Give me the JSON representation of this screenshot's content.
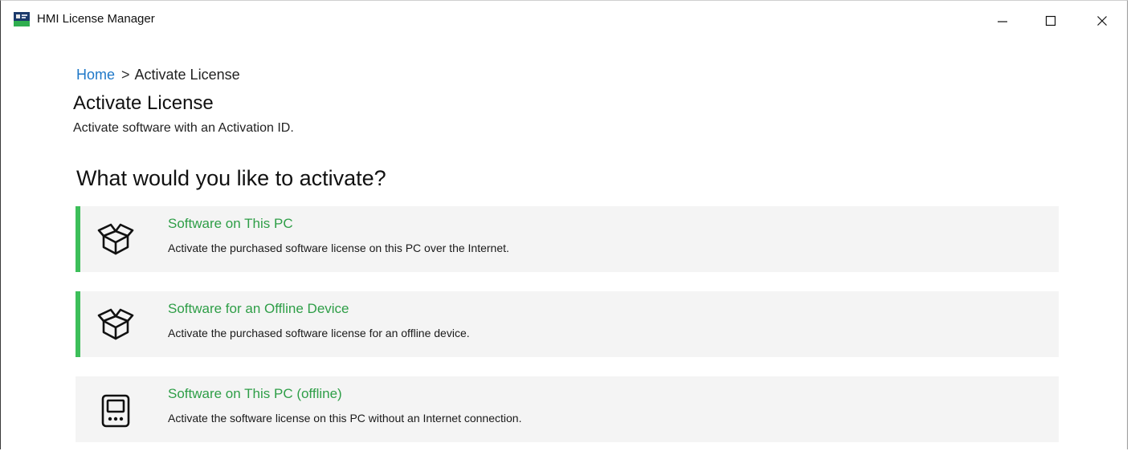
{
  "window": {
    "title": "HMI License Manager",
    "controls": {
      "minimize": "minimize-icon",
      "maximize": "maximize-icon",
      "close": "close-icon"
    }
  },
  "breadcrumb": {
    "home": "Home",
    "separator": ">",
    "current": "Activate License"
  },
  "page": {
    "title": "Activate License",
    "subtitle": "Activate software with an Activation ID."
  },
  "section": {
    "heading": "What would you like to activate?"
  },
  "options": [
    {
      "title": "Software on This PC",
      "description": "Activate the purchased software license on this PC over the Internet.",
      "icon": "package-box-icon",
      "accent": true
    },
    {
      "title": "Software for an Offline Device",
      "description": "Activate the purchased software license for an offline device.",
      "icon": "package-box-icon",
      "accent": true
    },
    {
      "title": "Software on This PC (offline)",
      "description": "Activate the software license on this PC without an Internet connection.",
      "icon": "device-screen-icon",
      "accent": false
    }
  ],
  "colors": {
    "accent_green": "#3dbf5a",
    "link_blue": "#1f78c8",
    "option_title_green": "#2e9e47",
    "option_background": "#f4f4f4"
  }
}
